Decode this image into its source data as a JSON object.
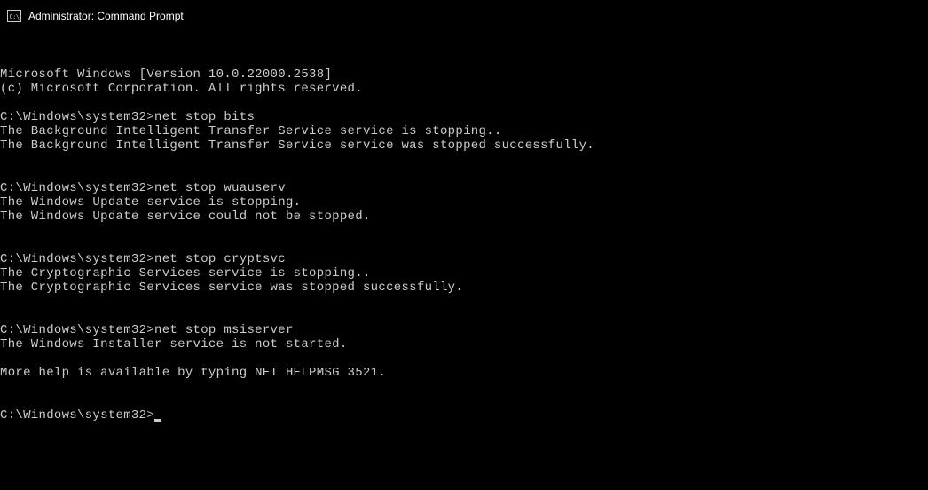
{
  "titlebar": {
    "icon_label": "C:\\",
    "title": "Administrator: Command Prompt"
  },
  "terminal": {
    "lines": [
      "Microsoft Windows [Version 10.0.22000.2538]",
      "(c) Microsoft Corporation. All rights reserved.",
      "",
      "C:\\Windows\\system32>net stop bits",
      "The Background Intelligent Transfer Service service is stopping..",
      "The Background Intelligent Transfer Service service was stopped successfully.",
      "",
      "",
      "C:\\Windows\\system32>net stop wuauserv",
      "The Windows Update service is stopping.",
      "The Windows Update service could not be stopped.",
      "",
      "",
      "C:\\Windows\\system32>net stop cryptsvc",
      "The Cryptographic Services service is stopping..",
      "The Cryptographic Services service was stopped successfully.",
      "",
      "",
      "C:\\Windows\\system32>net stop msiserver",
      "The Windows Installer service is not started.",
      "",
      "More help is available by typing NET HELPMSG 3521.",
      "",
      ""
    ],
    "current_prompt": "C:\\Windows\\system32>"
  }
}
